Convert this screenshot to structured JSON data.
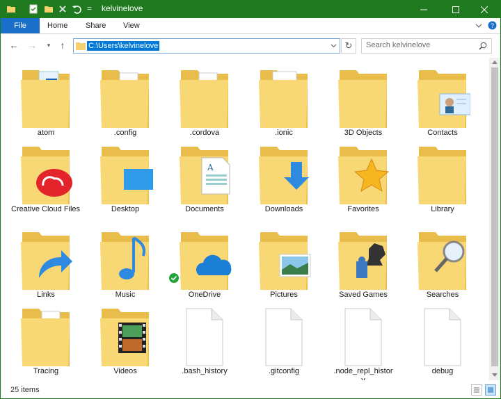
{
  "window": {
    "title": "kelvinelove",
    "title_separator": "=",
    "accent": "#1f7a1f"
  },
  "titlebar_icons": [
    "folder-icon",
    "properties-icon",
    "new-folder-icon",
    "delete-icon",
    "undo-icon"
  ],
  "window_controls": [
    "minimize-icon",
    "maximize-icon",
    "close-icon"
  ],
  "ribbon": {
    "file_label": "File",
    "tabs": [
      "Home",
      "Share",
      "View"
    ],
    "expand_icon": "chevron-down-icon",
    "help_icon": "help-icon"
  },
  "nav": {
    "address": "C:\\Users\\kelvinelove",
    "search_placeholder": "Search kelvinelove"
  },
  "items": [
    {
      "label": "atom",
      "icon": "folder-document-icon"
    },
    {
      "label": ".config",
      "icon": "folder-document-icon"
    },
    {
      "label": ".cordova",
      "icon": "folder-document-icon"
    },
    {
      "label": ".ionic",
      "icon": "folder-document-icon"
    },
    {
      "label": "3D Objects",
      "icon": "folder-icon"
    },
    {
      "label": "Contacts",
      "icon": "contacts-folder-icon"
    },
    {
      "label": "Creative Cloud Files",
      "icon": "creative-cloud-folder-icon"
    },
    {
      "label": "Desktop",
      "icon": "desktop-folder-icon"
    },
    {
      "label": "Documents",
      "icon": "documents-folder-icon"
    },
    {
      "label": "Downloads",
      "icon": "downloads-folder-icon"
    },
    {
      "label": "Favorites",
      "icon": "favorites-folder-icon"
    },
    {
      "label": "Library",
      "icon": "folder-icon"
    },
    {
      "label": "Links",
      "icon": "links-folder-icon"
    },
    {
      "label": "Music",
      "icon": "music-folder-icon"
    },
    {
      "label": "OneDrive",
      "icon": "onedrive-folder-icon"
    },
    {
      "label": "Pictures",
      "icon": "pictures-folder-icon"
    },
    {
      "label": "Saved Games",
      "icon": "saved-games-folder-icon"
    },
    {
      "label": "Searches",
      "icon": "searches-folder-icon"
    },
    {
      "label": "Tracing",
      "icon": "folder-document-icon"
    },
    {
      "label": "Videos",
      "icon": "videos-folder-icon"
    },
    {
      "label": ".bash_history",
      "icon": "file-icon"
    },
    {
      "label": ".gitconfig",
      "icon": "file-icon"
    },
    {
      "label": ".node_repl_history",
      "icon": "file-icon"
    },
    {
      "label": "debug",
      "icon": "file-icon"
    }
  ],
  "status": {
    "count": "25 items"
  }
}
